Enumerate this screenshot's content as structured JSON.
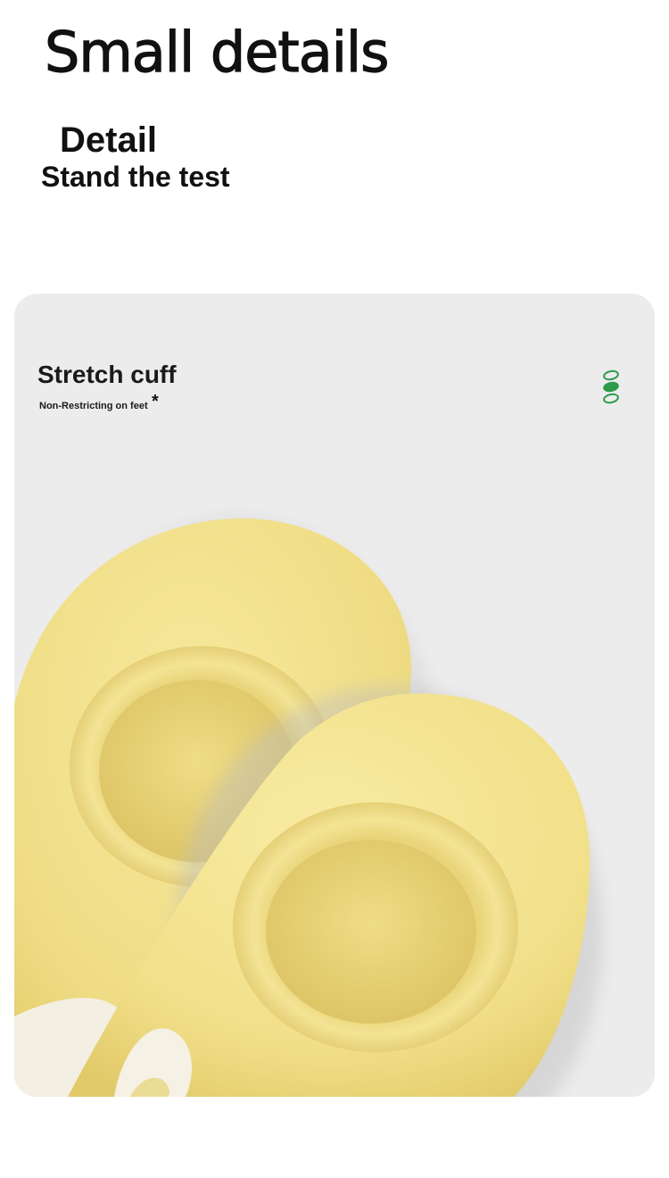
{
  "header": {
    "title": "Small details",
    "subheading": "Detail",
    "tagline": "Stand the test"
  },
  "card": {
    "feature_title": "Stretch cuff",
    "feature_description": "Non-Restricting on feet",
    "asterisk": "*",
    "pager": {
      "count": 3,
      "active_index": 1
    },
    "image_icon": "yellow-no-show-socks-image"
  },
  "colors": {
    "background": "#ffffff",
    "card_background": "#ececec",
    "sock_yellow": "#f3e38f",
    "pager_green": "#2e9a4b",
    "text": "#111111"
  }
}
